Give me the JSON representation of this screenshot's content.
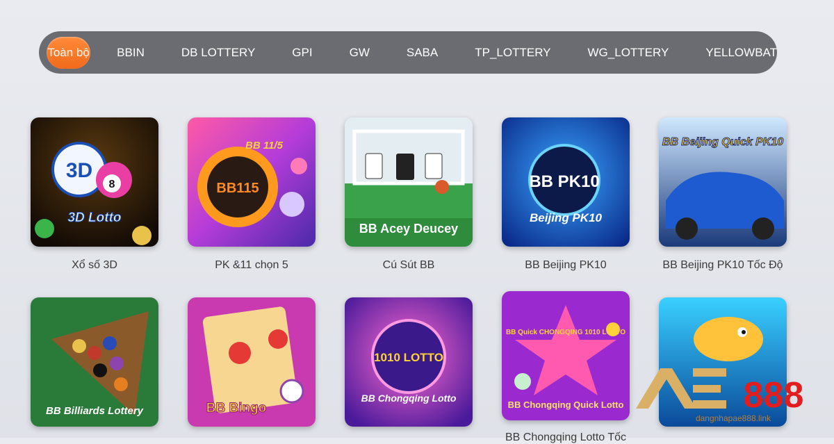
{
  "tabs": [
    {
      "label": "Toàn bộ",
      "active": true
    },
    {
      "label": "BBIN"
    },
    {
      "label": "DB LOTTERY"
    },
    {
      "label": "GPI"
    },
    {
      "label": "GW"
    },
    {
      "label": "SABA"
    },
    {
      "label": "TP_LOTTERY"
    },
    {
      "label": "WG_LOTTERY"
    },
    {
      "label": "YELLOWBAT"
    }
  ],
  "games": [
    {
      "title": "Xổ số 3D",
      "art_text": "3D Lotto",
      "art_badge": "3D"
    },
    {
      "title": "PK &11 chọn 5",
      "art_text": "BB 11/5",
      "art_badge": "BB115"
    },
    {
      "title": "Cú Sút BB",
      "art_text": "BB Acey Deucey"
    },
    {
      "title": "BB Beijing PK10",
      "art_text": "Beijing PK10",
      "art_badge": "BB PK10"
    },
    {
      "title": "BB Beijing PK10 Tốc Độ",
      "art_text": "BB Beijing Quick PK10"
    },
    {
      "title": "",
      "art_text": "BB Billiards Lottery"
    },
    {
      "title": "",
      "art_text": "BB Bingo"
    },
    {
      "title": "",
      "art_text": "BB Chongqing Lotto",
      "art_badge": "1010 LOTTO"
    },
    {
      "title": "BB Chongqing Lotto Tốc",
      "art_text": "BB Chongqing Quick Lotto",
      "art_badge": "BB Quick CHONGQING 1010 LOTTO"
    },
    {
      "title": "",
      "art_text": ""
    }
  ],
  "watermark": {
    "brand": "AE888",
    "url": "dangnhapae888.link"
  },
  "colors": {
    "tab_bar": "#6a6c72",
    "tab_active": "#f26a1b",
    "caption": "#3a3a3a"
  }
}
